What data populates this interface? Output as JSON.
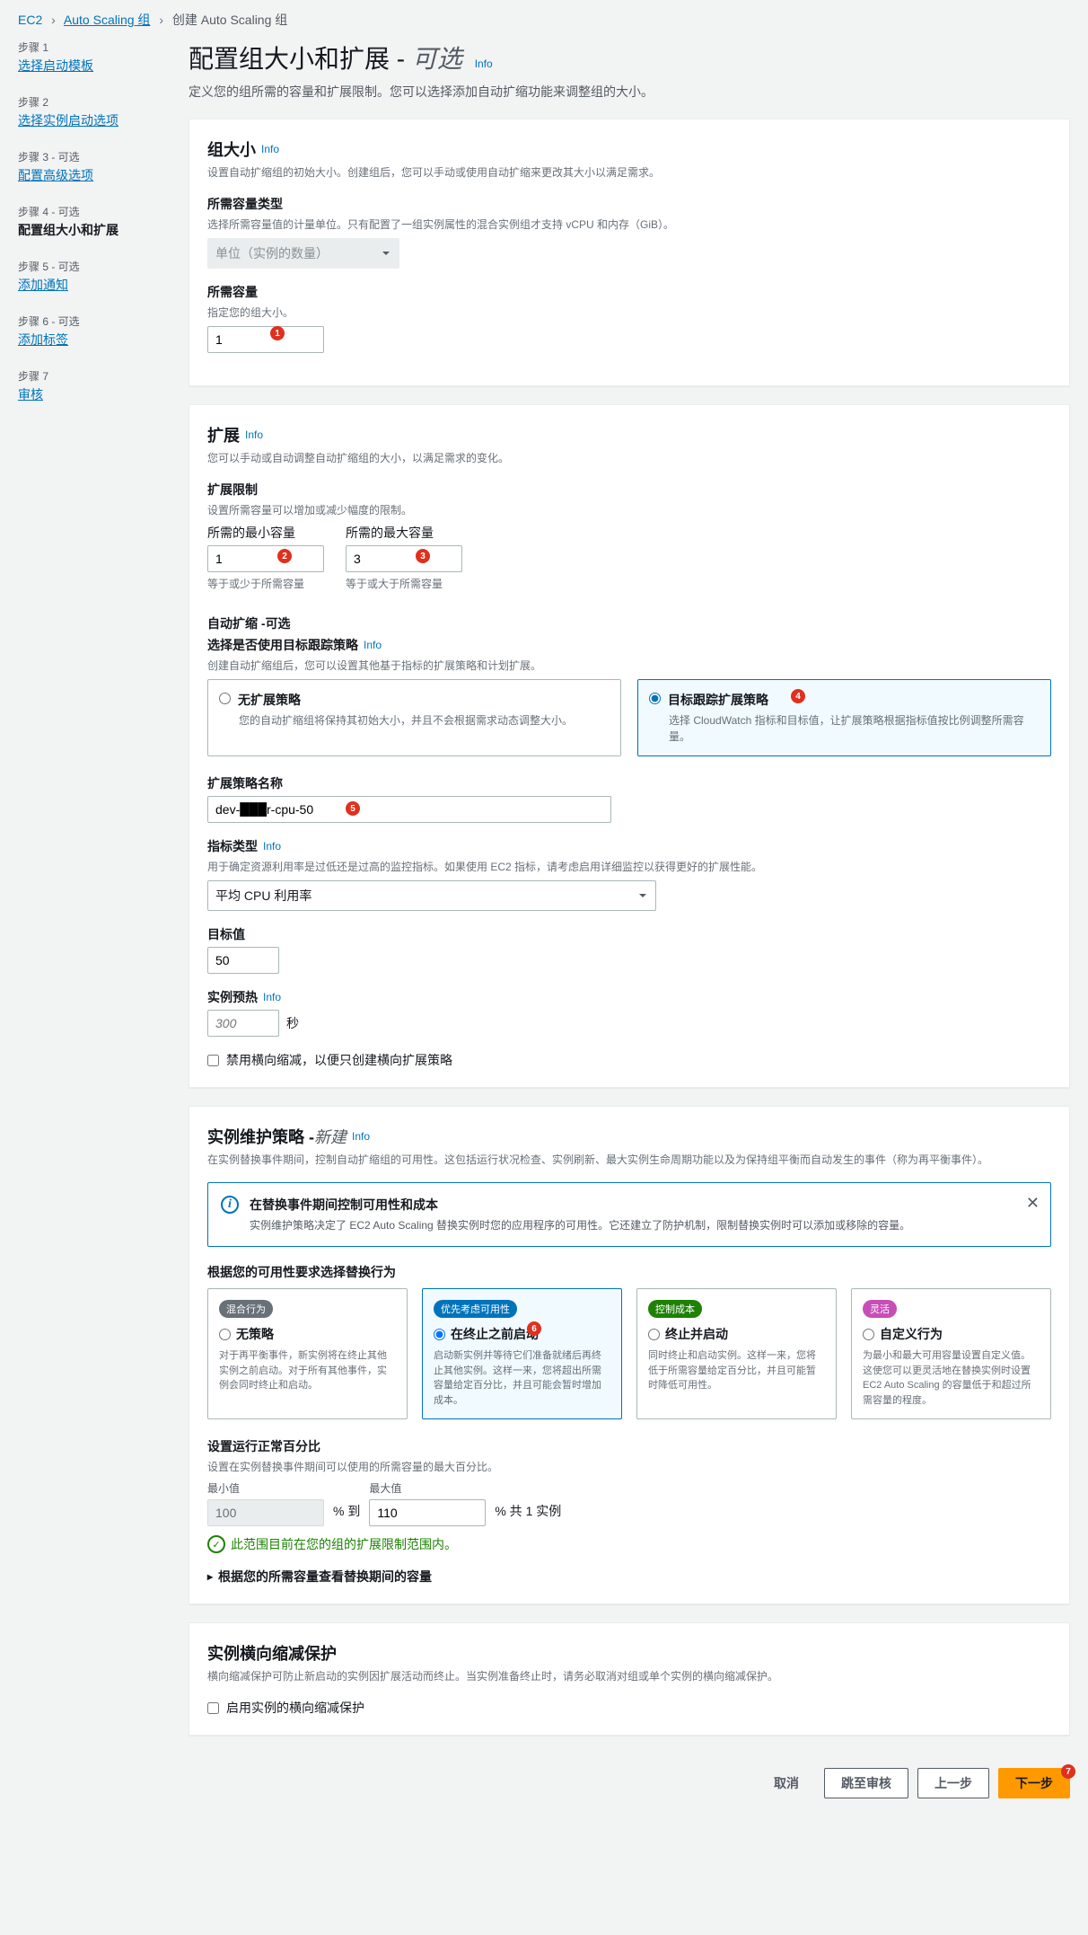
{
  "breadcrumb": {
    "ec2": "EC2",
    "asg": "Auto Scaling 组",
    "current": "创建 Auto Scaling 组"
  },
  "steps": [
    {
      "label": "步骤 1",
      "link": "选择启动模板"
    },
    {
      "label": "步骤 2",
      "link": "选择实例启动选项"
    },
    {
      "label": "步骤 3 - 可选",
      "link": "配置高级选项"
    },
    {
      "label": "步骤 4 - 可选",
      "link": "配置组大小和扩展"
    },
    {
      "label": "步骤 5 - 可选",
      "link": "添加通知"
    },
    {
      "label": "步骤 6 - 可选",
      "link": "添加标签"
    },
    {
      "label": "步骤 7",
      "link": "审核"
    }
  ],
  "page": {
    "title": "配置组大小和扩展 - ",
    "optional": "可选",
    "info": "Info",
    "desc": "定义您的组所需的容量和扩展限制。您可以选择添加自动扩缩功能来调整组的大小。"
  },
  "groupSize": {
    "title": "组大小",
    "info": "Info",
    "desc": "设置自动扩缩组的初始大小。创建组后，您可以手动或使用自动扩缩来更改其大小以满足需求。",
    "capTypeLabel": "所需容量类型",
    "capTypeHint": "选择所需容量值的计量单位。只有配置了一组实例属性的混合实例组才支持 vCPU 和内存（GiB）。",
    "capTypeValue": "单位（实例的数量）",
    "desiredLabel": "所需容量",
    "desiredHint": "指定您的组大小。",
    "desiredValue": "1"
  },
  "scaling": {
    "title": "扩展",
    "info": "Info",
    "desc": "您可以手动或自动调整自动扩缩组的大小，以满足需求的变化。",
    "limitTitle": "扩展限制",
    "limitHint": "设置所需容量可以增加或减少幅度的限制。",
    "minLabel": "所需的最小容量",
    "minValue": "1",
    "minHelp": "等于或少于所需容量",
    "maxLabel": "所需的最大容量",
    "maxValue": "3",
    "maxHelp": "等于或大于所需容量",
    "autoTitle": "自动扩缩 - ",
    "autoOptional": "可选",
    "autoSub": "选择是否使用目标跟踪策略",
    "autoInfo": "Info",
    "autoHint": "创建自动扩缩组后，您可以设置其他基于指标的扩展策略和计划扩展。",
    "noPolicyTitle": "无扩展策略",
    "noPolicyDesc": "您的自动扩缩组将保持其初始大小，并且不会根据需求动态调整大小。",
    "ttPolicyTitle": "目标跟踪扩展策略",
    "ttPolicyDesc": "选择 CloudWatch 指标和目标值，让扩展策略根据指标值按比例调整所需容量。",
    "policyNameLabel": "扩展策略名称",
    "policyNameValue": "dev-███r-cpu-50",
    "metricLabel": "指标类型",
    "metricInfo": "Info",
    "metricHint": "用于确定资源利用率是过低还是过高的监控指标。如果使用 EC2 指标，请考虑启用详细监控以获得更好的扩展性能。",
    "metricValue": "平均 CPU 利用率",
    "targetLabel": "目标值",
    "targetValue": "50",
    "warmupLabel": "实例预热",
    "warmupInfo": "Info",
    "warmupValue": "300",
    "warmupUnit": "秒",
    "disableScaleIn": "禁用横向缩减，以便只创建横向扩展策略"
  },
  "maint": {
    "title": "实例维护策略 - ",
    "new": "新建",
    "info": "Info",
    "desc": "在实例替换事件期间，控制自动扩缩组的可用性。这包括运行状况检查、实例刷新、最大实例生命周期功能以及为保持组平衡而自动发生的事件（称为再平衡事件）。",
    "alertTitle": "在替换事件期间控制可用性和成本",
    "alertBody": "实例维护策略决定了 EC2 Auto Scaling 替换实例时您的应用程序的可用性。它还建立了防护机制，限制替换实例时可以添加或移除的容量。",
    "chooseLabel": "根据您的可用性要求选择替换行为",
    "b0": {
      "badge": "混合行为",
      "title": "无策略",
      "desc": "对于再平衡事件，新实例将在终止其他实例之前启动。对于所有其他事件，实例会同时终止和启动。"
    },
    "b1": {
      "badge": "优先考虑可用性",
      "title": "在终止之前启动",
      "desc": "启动新实例并等待它们准备就绪后再终止其他实例。这样一来，您将超出所需容量给定百分比，并且可能会暂时增加成本。"
    },
    "b2": {
      "badge": "控制成本",
      "title": "终止并启动",
      "desc": "同时终止和启动实例。这样一来，您将低于所需容量给定百分比，并且可能暂时降低可用性。"
    },
    "b3": {
      "badge": "灵活",
      "title": "自定义行为",
      "desc": "为最小和最大可用容量设置自定义值。这使您可以更灵活地在替换实例时设置 EC2 Auto Scaling 的容量低于和超过所需容量的程度。"
    },
    "pctTitle": "设置运行正常百分比",
    "pctHint": "设置在实例替换事件期间可以使用的所需容量的最大百分比。",
    "minLabel": "最小值",
    "minValue": "100",
    "pctTo": "% 到",
    "maxLabel": "最大值",
    "maxValue": "110",
    "pctSuffix": "% 共 1 实例",
    "okMsg": "此范围目前在您的组的扩展限制范围内。",
    "expand": "根据您的所需容量查看替换期间的容量"
  },
  "protect": {
    "title": "实例横向缩减保护",
    "desc": "横向缩减保护可防止新启动的实例因扩展活动而终止。当实例准备终止时，请务必取消对组或单个实例的横向缩减保护。",
    "check": "启用实例的横向缩减保护"
  },
  "footer": {
    "cancel": "取消",
    "skip": "跳至审核",
    "prev": "上一步",
    "next": "下一步"
  }
}
